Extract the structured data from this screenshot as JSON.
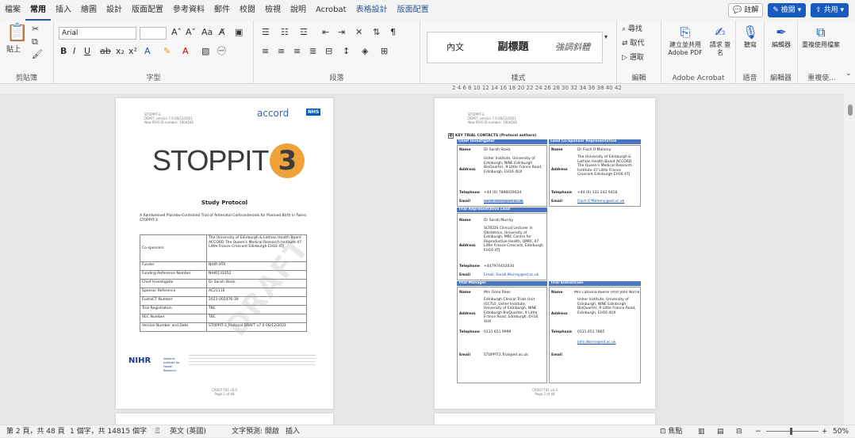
{
  "tabs": [
    "檔案",
    "常用",
    "插入",
    "繪圖",
    "設計",
    "版面配置",
    "參考資料",
    "郵件",
    "校閱",
    "檢視",
    "說明",
    "Acrobat",
    "表格設計",
    "版面配置"
  ],
  "tab_right": {
    "comments": "註解",
    "editing": "檢閱",
    "share": "共用"
  },
  "ribbon": {
    "clipboard": {
      "paste": "貼上",
      "label": "剪貼簿"
    },
    "font": {
      "name": "Arial",
      "size": "",
      "label": "字型",
      "change_case": "Aa"
    },
    "paragraph": {
      "label": "段落"
    },
    "styles": {
      "items": [
        "內文",
        "副標題",
        "強調斜體"
      ],
      "label": "樣式"
    },
    "editing": {
      "find": "尋找",
      "replace": "取代",
      "select": "選取",
      "label": "編輯"
    },
    "acrobat": {
      "create": "建立並共用 Adobe PDF",
      "request": "請求 簽名",
      "label": "Adobe Acrobat"
    },
    "voice": {
      "dictate": "聽寫",
      "label": "語音"
    },
    "editor": {
      "editor": "編輯器",
      "label": "編輯器"
    },
    "reuse": {
      "reuse": "重複使用檔案",
      "label": "重複使..."
    }
  },
  "ruler": {
    "marks": "2 4 6 8 10 12 14 16 18 20 22 24 26 28 30 32 34 36 38 40 42"
  },
  "page1": {
    "header": [
      "STOPPIT-3",
      "DRAFT version 7.0 08/12/2021",
      "New IRAS ID number: 1004169"
    ],
    "accord": "accord",
    "nhs": "NHS",
    "logo": "STOPPIT",
    "logo_num": "3",
    "title": "Study Protocol",
    "subtitle": "A Randomised Placebo-Controlled Trial of Antenatal Corticosteroids for Planned Birth in Twins: STOPPIT-3",
    "table": [
      [
        "Co-sponsors",
        "The University of Edinburgh & Lothian Health Board ACCORD The Queen's Medical Research Institute 47 Little France Crescent Edinburgh EH16 4TJ"
      ],
      [
        "Funder",
        "NIHR HTA"
      ],
      [
        "Funding Reference Number",
        "NIHR131052"
      ],
      [
        "Chief Investigator",
        "Dr Sarah Stock"
      ],
      [
        "Sponsor Reference",
        "AC21116"
      ],
      [
        "EudraCT Number",
        "2021-002476-39"
      ],
      [
        "Trial Registration",
        "TBC"
      ],
      [
        "REC Number",
        "TBC"
      ],
      [
        "Version Number and Date",
        "STOPPIT-3_Protocol DRAFT v7.0 08/12/2021"
      ]
    ],
    "watermark": "DRAFT",
    "nihr": "NIHR",
    "nihr_sub": "National Institute for Health Research",
    "footer": [
      "CR007-T01 v6.0",
      "Page 1 of 48"
    ]
  },
  "page2": {
    "header": [
      "STOPPIT-3",
      "DRAFT version 7.0 08/12/2021",
      "New IRAS ID number: 1004169"
    ],
    "heading": "KEY TRIAL CONTACTS (Protocol authors)",
    "ci": "Chief Investigator",
    "lcs": "Lead Co-Sponsor Representative",
    "name_lbl": "Name",
    "address_lbl": "Address",
    "tel_lbl": "Telephone",
    "email_lbl": "Email",
    "ci_name": "Dr Sarah Stock",
    "ci_addr": "Usher Institute, University of Edinburgh, NINE Edinburgh BioQuarter, 9 Little France Road, Edinburgh, EH16 4UX",
    "ci_tel": "+44 (0) 7896029034",
    "ci_email": "sarah.stock@ed.ac.uk",
    "lcs_name": "Dr Fiach O'Mahony",
    "lcs_addr": "The University of Edinburgh & Lothian Health Board ACCORD The Queen's Medical Research Institute 47 Little France Crescent Edinburgh EH16 4TJ",
    "lcs_tel": "+44 (0) 131 242 9418",
    "lcs_email": "Fiach.O'Mahony@ed.ac.uk",
    "tel": "Trial Representative Lead",
    "tr_name": "Dr Sarah Murray",
    "tr_addr": "SCREDS Clinical Lecturer in Obstetrics, University of Edinburgh, MRC Centre for Reproductive Health, QMRI, 47 Little France Crescent, Edinburgh EH16 4TJ",
    "tr_tel": "+447974432034",
    "tr_email": "Email: Sarah.Murray@ed.ac.uk",
    "tm": "Trial Manager",
    "ts": "Trial Statistician",
    "tm_name": "Mrs Fiona Rees",
    "tm_addr": "Edinburgh Clinical Trials Unit (ECTU), Usher Institute, University of Edinburgh, NINE Edinburgh BioQuarter, 9 Little France Road, Edinburgh, EH16 4UX",
    "tm_tel": "0131 651 9999",
    "tm_email": "STOPPIT3.Trial@ed.ac.uk",
    "ts_name": "Mrs Catriona Keerie (Prof John Norrie)",
    "ts_addr": "Usher Institute, University of Edinburgh, NINE Edinburgh BioQuarter, 9 Little France Road, Edinburgh, EH16 4UX",
    "ts_tel": "0131 651 7865",
    "ts_email": "John.Norrie@ed.ac.uk",
    "footer": [
      "CR007-T01 v6.0",
      "Page 2 of 48"
    ]
  },
  "status": {
    "page": "第 2 頁，共 48 頁",
    "words": "1 個字，共 14815 個字",
    "lang": "英文 (英國)",
    "predict": "文字預測: 開啟",
    "insert": "插入",
    "focus": "焦點",
    "zoom": "50%"
  }
}
